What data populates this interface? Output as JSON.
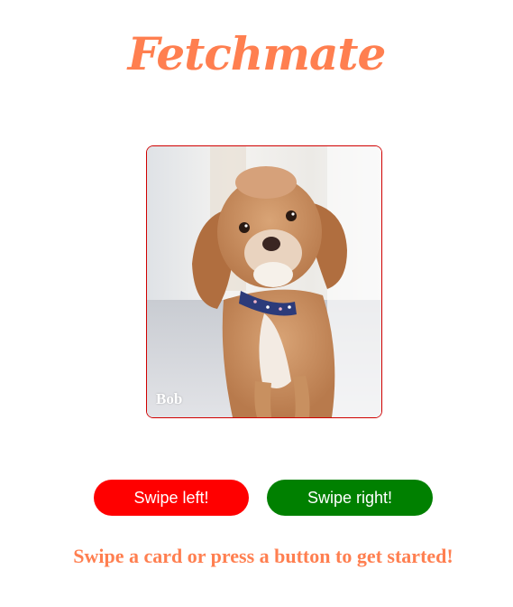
{
  "app": {
    "title": "Fetchmate",
    "accent_color": "#ff7f50"
  },
  "card": {
    "name": "Bob",
    "image": "dog-photo",
    "border_color": "#d00000"
  },
  "buttons": {
    "left_label": "Swipe left!",
    "left_color": "#ff0000",
    "right_label": "Swipe right!",
    "right_color": "#008000"
  },
  "status": {
    "message": "Swipe a card or press a button to get started!"
  }
}
